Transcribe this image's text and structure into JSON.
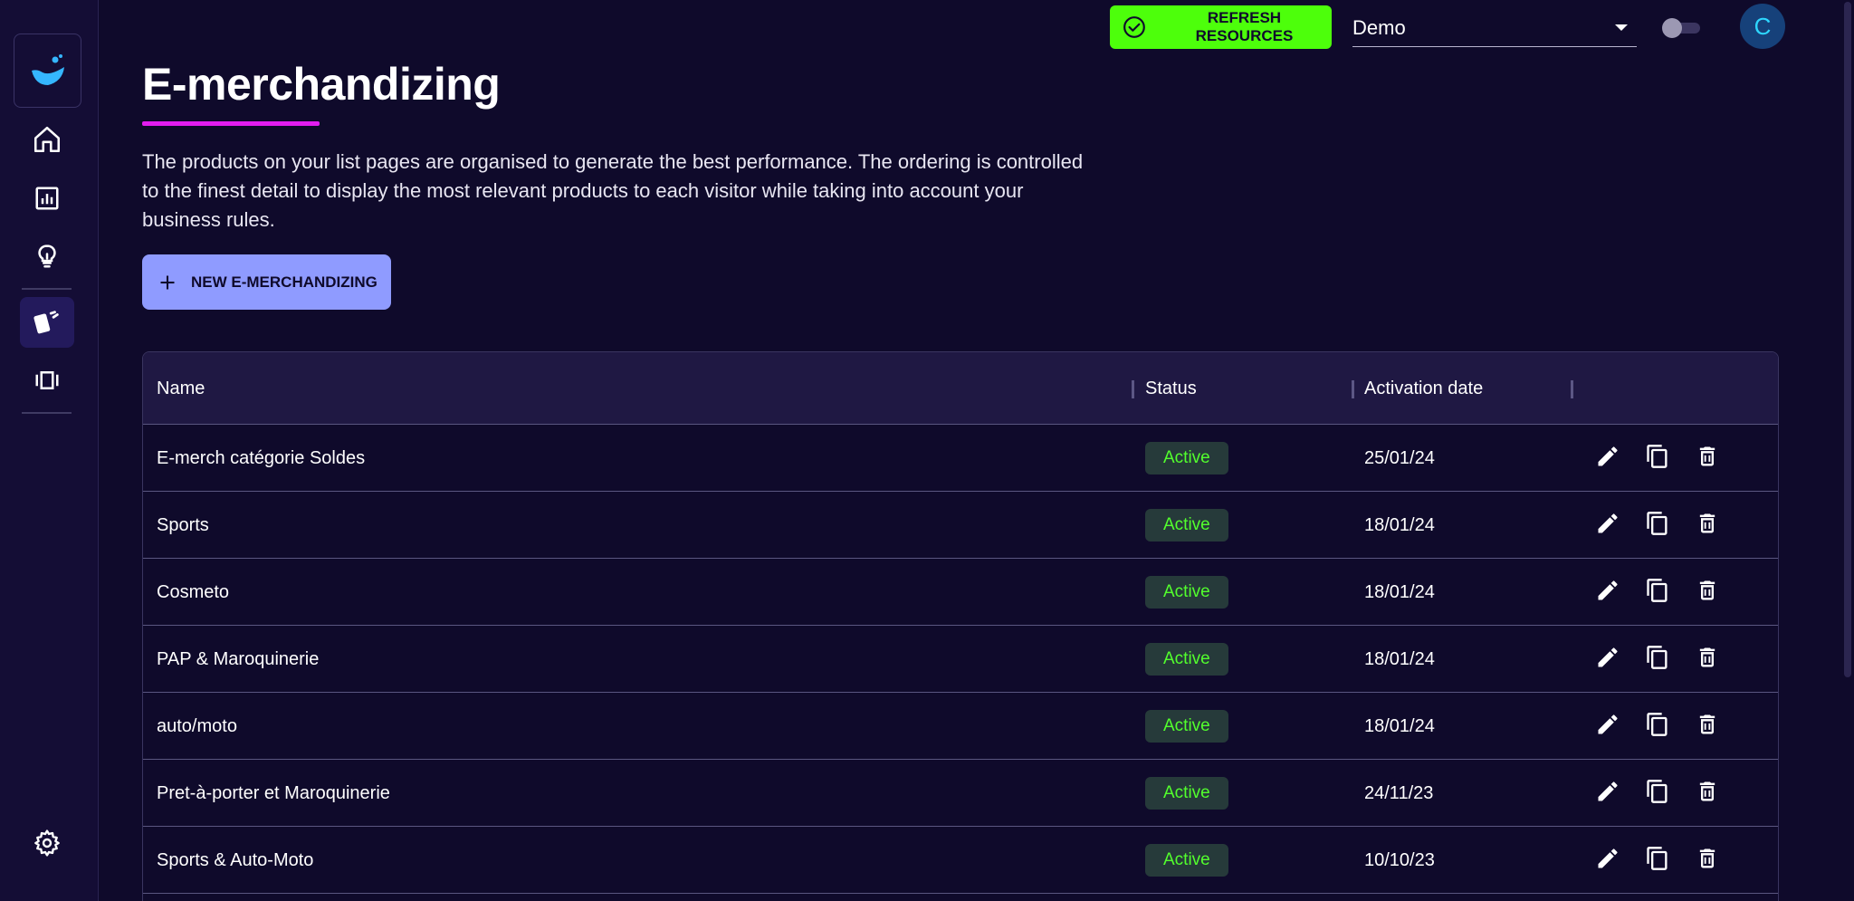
{
  "topbar": {
    "refresh_label": "REFRESH RESOURCES",
    "workspace_selected": "Demo",
    "avatar_initial": "C"
  },
  "sidebar": {
    "items": [
      {
        "name": "home",
        "icon": "home-icon",
        "active": false
      },
      {
        "name": "analytics",
        "icon": "bar-chart-icon",
        "active": false
      },
      {
        "name": "insights",
        "icon": "lightbulb-icon",
        "active": false
      },
      {
        "name": "e-merchandizing",
        "icon": "cards-icon",
        "active": true
      },
      {
        "name": "carousel",
        "icon": "carousel-icon",
        "active": false
      }
    ],
    "settings_icon": "gear-icon"
  },
  "page": {
    "title": "E-merchandizing",
    "description": "The products on your list pages are organised to generate the best performance. The ordering is controlled to the finest detail to display the most relevant products to each visitor while taking into account your business rules.",
    "new_button_label": "NEW E-MERCHANDIZING"
  },
  "table": {
    "headers": {
      "name": "Name",
      "status": "Status",
      "activation_date": "Activation date"
    },
    "rows": [
      {
        "name": "E-merch catégorie Soldes",
        "status": "Active",
        "date": "25/01/24"
      },
      {
        "name": "Sports",
        "status": "Active",
        "date": "18/01/24"
      },
      {
        "name": "Cosmeto",
        "status": "Active",
        "date": "18/01/24"
      },
      {
        "name": "PAP & Maroquinerie",
        "status": "Active",
        "date": "18/01/24"
      },
      {
        "name": "auto/moto",
        "status": "Active",
        "date": "18/01/24"
      },
      {
        "name": "Pret-à-porter et Maroquinerie",
        "status": "Active",
        "date": "24/11/23"
      },
      {
        "name": "Sports & Auto-Moto",
        "status": "Active",
        "date": "10/10/23"
      }
    ]
  },
  "colors": {
    "background": "#0f0a2b",
    "accent_green": "#4dff0b",
    "accent_purple": "#8f9bff",
    "accent_magenta": "#e21df0",
    "status_active": "#52ff2d"
  }
}
